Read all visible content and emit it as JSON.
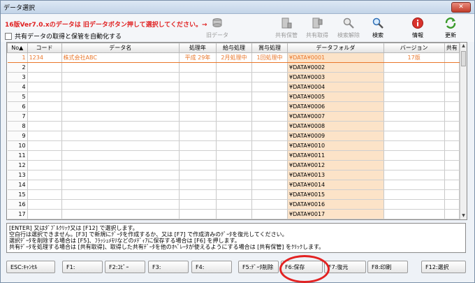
{
  "window": {
    "title": "データ選択",
    "close_label": "✕"
  },
  "toolbar": {
    "notice": "16版Ver7.0.xのデータは 旧データボタン押して選択してください。→",
    "auto_label": "共有データの取得と保管を自動化する",
    "buttons": [
      {
        "label": "旧データ",
        "icon": "stack-icon",
        "disabled": true
      },
      {
        "label": "共有保管",
        "icon": "server-save-icon",
        "disabled": true
      },
      {
        "label": "共有取得",
        "icon": "server-get-icon",
        "disabled": true
      },
      {
        "label": "検索解除",
        "icon": "search-clear-icon",
        "disabled": true
      },
      {
        "label": "検索",
        "icon": "search-icon",
        "disabled": false
      },
      {
        "label": "情報",
        "icon": "info-icon",
        "disabled": false
      },
      {
        "label": "更新",
        "icon": "refresh-icon",
        "disabled": false
      }
    ]
  },
  "grid": {
    "headers": [
      "No▲",
      "コード",
      "データ名",
      "処理年",
      "給与処理",
      "賞与処理",
      "データフォルダ",
      "バージョン",
      "共有"
    ],
    "rows": [
      {
        "no": "1",
        "code": "1234",
        "name": "株式会社ABC",
        "year": "平成 29年",
        "salary": "2月処理中",
        "bonus": "1回処理中",
        "folder": "¥DATA¥0001",
        "version": "17版",
        "shared": ""
      },
      {
        "no": "2",
        "code": "",
        "name": "",
        "year": "",
        "salary": "",
        "bonus": "",
        "folder": "¥DATA¥0002",
        "version": "",
        "shared": ""
      },
      {
        "no": "3",
        "code": "",
        "name": "",
        "year": "",
        "salary": "",
        "bonus": "",
        "folder": "¥DATA¥0003",
        "version": "",
        "shared": ""
      },
      {
        "no": "4",
        "code": "",
        "name": "",
        "year": "",
        "salary": "",
        "bonus": "",
        "folder": "¥DATA¥0004",
        "version": "",
        "shared": ""
      },
      {
        "no": "5",
        "code": "",
        "name": "",
        "year": "",
        "salary": "",
        "bonus": "",
        "folder": "¥DATA¥0005",
        "version": "",
        "shared": ""
      },
      {
        "no": "6",
        "code": "",
        "name": "",
        "year": "",
        "salary": "",
        "bonus": "",
        "folder": "¥DATA¥0006",
        "version": "",
        "shared": ""
      },
      {
        "no": "7",
        "code": "",
        "name": "",
        "year": "",
        "salary": "",
        "bonus": "",
        "folder": "¥DATA¥0007",
        "version": "",
        "shared": ""
      },
      {
        "no": "8",
        "code": "",
        "name": "",
        "year": "",
        "salary": "",
        "bonus": "",
        "folder": "¥DATA¥0008",
        "version": "",
        "shared": ""
      },
      {
        "no": "9",
        "code": "",
        "name": "",
        "year": "",
        "salary": "",
        "bonus": "",
        "folder": "¥DATA¥0009",
        "version": "",
        "shared": ""
      },
      {
        "no": "10",
        "code": "",
        "name": "",
        "year": "",
        "salary": "",
        "bonus": "",
        "folder": "¥DATA¥0010",
        "version": "",
        "shared": ""
      },
      {
        "no": "11",
        "code": "",
        "name": "",
        "year": "",
        "salary": "",
        "bonus": "",
        "folder": "¥DATA¥0011",
        "version": "",
        "shared": ""
      },
      {
        "no": "12",
        "code": "",
        "name": "",
        "year": "",
        "salary": "",
        "bonus": "",
        "folder": "¥DATA¥0012",
        "version": "",
        "shared": ""
      },
      {
        "no": "13",
        "code": "",
        "name": "",
        "year": "",
        "salary": "",
        "bonus": "",
        "folder": "¥DATA¥0013",
        "version": "",
        "shared": ""
      },
      {
        "no": "14",
        "code": "",
        "name": "",
        "year": "",
        "salary": "",
        "bonus": "",
        "folder": "¥DATA¥0014",
        "version": "",
        "shared": ""
      },
      {
        "no": "15",
        "code": "",
        "name": "",
        "year": "",
        "salary": "",
        "bonus": "",
        "folder": "¥DATA¥0015",
        "version": "",
        "shared": ""
      },
      {
        "no": "16",
        "code": "",
        "name": "",
        "year": "",
        "salary": "",
        "bonus": "",
        "folder": "¥DATA¥0016",
        "version": "",
        "shared": ""
      },
      {
        "no": "17",
        "code": "",
        "name": "",
        "year": "",
        "salary": "",
        "bonus": "",
        "folder": "¥DATA¥0017",
        "version": "",
        "shared": ""
      }
    ]
  },
  "info_lines": [
    "[ENTER] 又はﾀﾞﾌﾞﾙｸﾘｯｸ又は [F12] で選択します。",
    "空白行は選択できません。[F3] で新規にﾃﾞｰﾀを作成するか、又は [F7] で作成済みのﾃﾞｰﾀを復元してください。",
    "選択ﾃﾞｰﾀを削除する場合は [F5]、ﾌﾗｯｼｭﾒﾓﾘなどのﾒﾃﾞｨｱに保存する場合は [F6] を押します。",
    "共有ﾃﾞｰﾀを処理する場合は [共有取得]、取得した共有ﾃﾞｰﾀを他のｵﾍﾟﾚｰﾀが使えるようにする場合は [共有保管] をｸﾘｯｸします。"
  ],
  "fkeys": [
    "ESC:ｷｬﾝｾﾙ",
    "F1:",
    "F2:ｺﾋﾟｰ",
    "F3:",
    "F4:",
    "F5:ﾃﾞｰﾀ削除",
    "F6:保存",
    "F7:復元",
    "F8:印刷",
    "F12:選択"
  ],
  "colors": {
    "accent_orange": "#e9772b",
    "notice_red": "#e02020",
    "highlight": "#e32222"
  }
}
